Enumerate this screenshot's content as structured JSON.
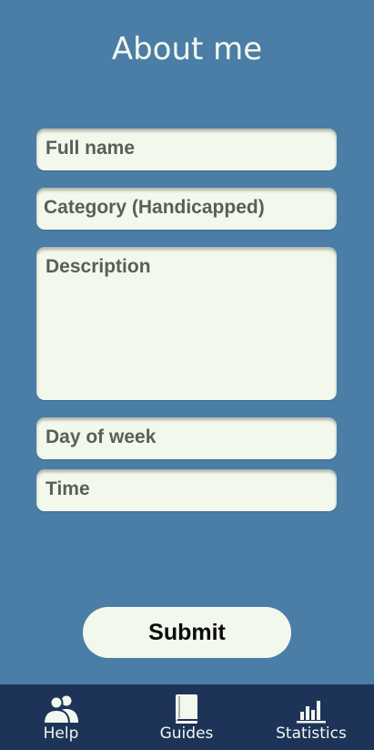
{
  "header": {
    "title": "About me"
  },
  "form": {
    "full_name": {
      "placeholder": "Full name"
    },
    "category": {
      "placeholder": "Category (Handicapped)"
    },
    "description": {
      "placeholder": "Description"
    },
    "day_of_week": {
      "placeholder": "Day of week"
    },
    "time": {
      "placeholder": "Time"
    },
    "submit_label": "Submit"
  },
  "bottom_nav": {
    "items": [
      {
        "label": "Help",
        "icon": "person-icon"
      },
      {
        "label": "Guides",
        "icon": "book-icon"
      },
      {
        "label": "Statistics",
        "icon": "bar-chart-icon"
      }
    ]
  },
  "colors": {
    "background": "#4a7ea6",
    "field_background": "#f2f8ec",
    "nav_background": "#1d3458",
    "text_light": "#f3f8ee",
    "placeholder_text": "#5b5d5b"
  }
}
